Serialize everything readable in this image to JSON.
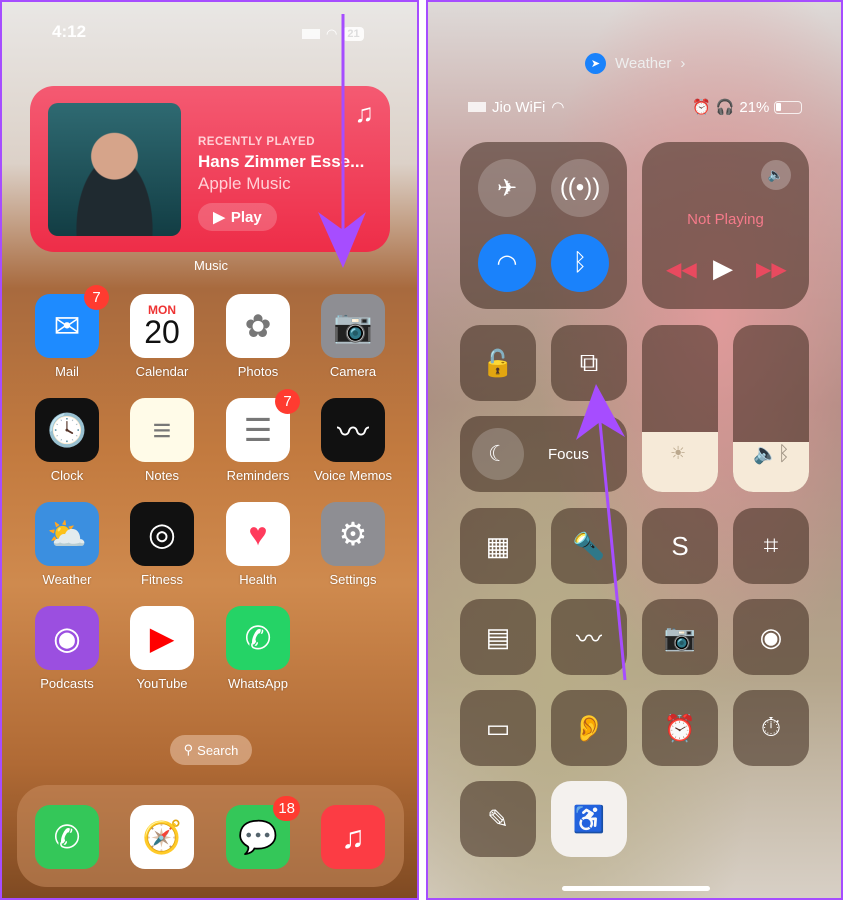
{
  "left": {
    "status": {
      "time": "4:12",
      "battery": "21"
    },
    "widget": {
      "eyebrow": "RECENTLY PLAYED",
      "title": "Hans Zimmer Esse...",
      "subtitle": "Apple Music",
      "play": "Play",
      "label": "Music"
    },
    "apps": [
      {
        "name": "Mail",
        "color": "#1e8bff",
        "glyph": "✉",
        "badge": "7"
      },
      {
        "name": "Calendar",
        "color": "#ffffff",
        "glyph": "",
        "day": "MON",
        "date": "20"
      },
      {
        "name": "Photos",
        "color": "#ffffff",
        "glyph": "✿"
      },
      {
        "name": "Camera",
        "color": "#8e8e93",
        "glyph": "📷"
      },
      {
        "name": "Clock",
        "color": "#111111",
        "glyph": "🕓"
      },
      {
        "name": "Notes",
        "color": "#fffbe8",
        "glyph": "≡"
      },
      {
        "name": "Reminders",
        "color": "#ffffff",
        "glyph": "☰",
        "badge": "7"
      },
      {
        "name": "Voice Memos",
        "color": "#111111",
        "glyph": "〰"
      },
      {
        "name": "Weather",
        "color": "#3b8fe0",
        "glyph": "⛅"
      },
      {
        "name": "Fitness",
        "color": "#111111",
        "glyph": "◎"
      },
      {
        "name": "Health",
        "color": "#ffffff",
        "glyph": "♥"
      },
      {
        "name": "Settings",
        "color": "#8e8e93",
        "glyph": "⚙"
      },
      {
        "name": "Podcasts",
        "color": "#9b4fe0",
        "glyph": "◉"
      },
      {
        "name": "YouTube",
        "color": "#ffffff",
        "glyph": "▶"
      },
      {
        "name": "WhatsApp",
        "color": "#25d366",
        "glyph": "✆"
      }
    ],
    "search": "Search",
    "dock": [
      {
        "name": "Phone",
        "color": "#34c759",
        "glyph": "✆"
      },
      {
        "name": "Safari",
        "color": "#ffffff",
        "glyph": "🧭"
      },
      {
        "name": "Messages",
        "color": "#34c759",
        "glyph": "💬",
        "badge": "18"
      },
      {
        "name": "Music",
        "color": "#fc3c44",
        "glyph": "♫"
      }
    ]
  },
  "right": {
    "location_app": "Weather",
    "status": {
      "carrier": "Jio WiFi",
      "battery": "21%"
    },
    "now_playing": "Not Playing",
    "focus": "Focus",
    "controls": [
      "calculator-icon",
      "flashlight-icon",
      "shazam-icon",
      "qr-scanner-icon",
      "quick-note-icon",
      "voice-memo-icon",
      "camera-icon",
      "screen-record-icon",
      "low-power-icon",
      "hearing-icon",
      "alarm-icon",
      "stopwatch-icon",
      "markup-icon",
      "accessibility-icon"
    ],
    "control_glyphs": [
      "▦",
      "🔦",
      "S",
      "⌗",
      "▤",
      "〰",
      "📷",
      "◉",
      "▭",
      "👂",
      "⏰",
      "⏱",
      "✎",
      "♿"
    ]
  },
  "colors": {
    "arrow": "#a64dff",
    "accent_blue": "#1a82fb",
    "music_red": "#f0384f"
  }
}
